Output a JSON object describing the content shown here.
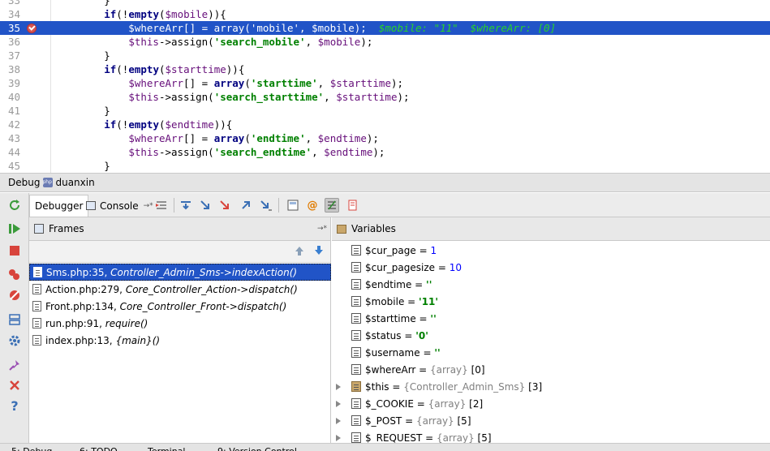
{
  "editor": {
    "lines": [
      {
        "no": "33",
        "code": "        }"
      },
      {
        "no": "34",
        "code": "        if(!empty($mobile)){"
      },
      {
        "no": "35",
        "code": "            $whereArr[] = array('mobile', $mobile);",
        "hint": "  $mobile: \"11\"  $whereArr: [0]",
        "current": true
      },
      {
        "no": "36",
        "code": "            $this->assign('search_mobile', $mobile);"
      },
      {
        "no": "37",
        "code": "        }"
      },
      {
        "no": "38",
        "code": "        if(!empty($starttime)){"
      },
      {
        "no": "39",
        "code": "            $whereArr[] = array('starttime', $starttime);"
      },
      {
        "no": "40",
        "code": "            $this->assign('search_starttime', $starttime);"
      },
      {
        "no": "41",
        "code": "        }"
      },
      {
        "no": "42",
        "code": "        if(!empty($endtime)){"
      },
      {
        "no": "43",
        "code": "            $whereArr[] = array('endtime', $endtime);"
      },
      {
        "no": "44",
        "code": "            $this->assign('search_endtime', $endtime);"
      },
      {
        "no": "45",
        "code": "        }"
      }
    ]
  },
  "debug": {
    "title": "Debug",
    "config_name": "duanxin",
    "tabs": {
      "debugger": "Debugger",
      "console": "Console"
    }
  },
  "frames": {
    "title": "Frames",
    "items": [
      {
        "file": "Sms.php:35,",
        "func": "Controller_Admin_Sms->indexAction()",
        "selected": true
      },
      {
        "file": "Action.php:279,",
        "func": "Core_Controller_Action->dispatch()"
      },
      {
        "file": "Front.php:134,",
        "func": "Core_Controller_Front->dispatch()"
      },
      {
        "file": "run.php:91,",
        "func": "require()"
      },
      {
        "file": "index.php:13,",
        "func": "{main}()"
      }
    ]
  },
  "variables": {
    "title": "Variables",
    "items": [
      {
        "name": "$cur_page",
        "eq": " = ",
        "value": "1",
        "kind": "num"
      },
      {
        "name": "$cur_pagesize",
        "eq": " = ",
        "value": "10",
        "kind": "num"
      },
      {
        "name": "$endtime",
        "eq": " = ",
        "value": "''",
        "kind": "str"
      },
      {
        "name": "$mobile",
        "eq": " = ",
        "value": "'11'",
        "kind": "str"
      },
      {
        "name": "$starttime",
        "eq": " = ",
        "value": "''",
        "kind": "str"
      },
      {
        "name": "$status",
        "eq": " = ",
        "value": "'0'",
        "kind": "str"
      },
      {
        "name": "$username",
        "eq": " = ",
        "value": "''",
        "kind": "str"
      },
      {
        "name": "$whereArr",
        "eq": " = ",
        "type": "{array}",
        "value": " [0]",
        "kind": "arr"
      },
      {
        "name": "$this",
        "eq": " = ",
        "type": "{Controller_Admin_Sms}",
        "value": " [3]",
        "kind": "obj",
        "expandable": true
      },
      {
        "name": "$_COOKIE",
        "eq": " = ",
        "type": "{array}",
        "value": " [2]",
        "kind": "arr",
        "expandable": true
      },
      {
        "name": "$_POST",
        "eq": " = ",
        "type": "{array}",
        "value": " [5]",
        "kind": "arr",
        "expandable": true
      },
      {
        "name": "$_REQUEST",
        "eq": " = ",
        "type": "{array}",
        "value": " [5]",
        "kind": "arr",
        "expandable": true
      }
    ]
  },
  "bottom": {
    "items": [
      "5: Debug",
      "6: TODO",
      "Terminal",
      "9: Version Control"
    ]
  },
  "icons": {
    "rerun": "rerun-icon",
    "resume": "resume-icon",
    "stop": "stop-icon",
    "view-breakpoints": "view-breakpoints-icon",
    "mute-breakpoints": "mute-breakpoints-icon",
    "settings": "settings-icon",
    "pin": "pin-icon",
    "close": "close-icon",
    "help": "help-icon"
  },
  "colors": {
    "accent": "#2154c7",
    "breakpoint": "#d65551",
    "hint": "#28d428"
  }
}
